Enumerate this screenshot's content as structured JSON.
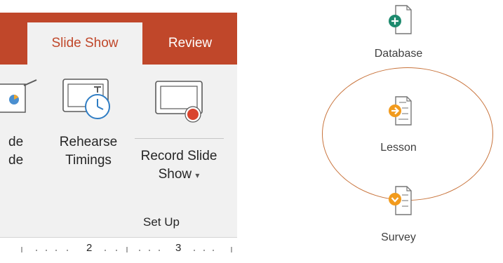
{
  "ribbon": {
    "tabs": [
      {
        "label": "Slide Show",
        "active": true
      },
      {
        "label": "Review",
        "active": false
      }
    ],
    "cut_button": {
      "line1": "de",
      "line2": "de"
    },
    "rehearse_button": {
      "line1": "Rehearse",
      "line2": "Timings"
    },
    "record_button": {
      "line1": "Record Slide",
      "line2": "Show",
      "caret": "▾"
    },
    "group_label": "Set Up",
    "ruler": {
      "marks": [
        "2",
        "3"
      ]
    }
  },
  "modules": [
    {
      "label": "Database",
      "icon": "add-document-icon",
      "badge_color": "#1e8a6e"
    },
    {
      "label": "Lesson",
      "icon": "lesson-document-icon",
      "badge_color": "#f29b1d"
    },
    {
      "label": "Survey",
      "icon": "survey-document-icon",
      "badge_color": "#f29b1d"
    }
  ],
  "colors": {
    "ribbon_accent": "#c0472a",
    "ribbon_panel": "#f1f1f1",
    "highlight_circle": "#c8733b",
    "record_dot": "#d9442e"
  }
}
